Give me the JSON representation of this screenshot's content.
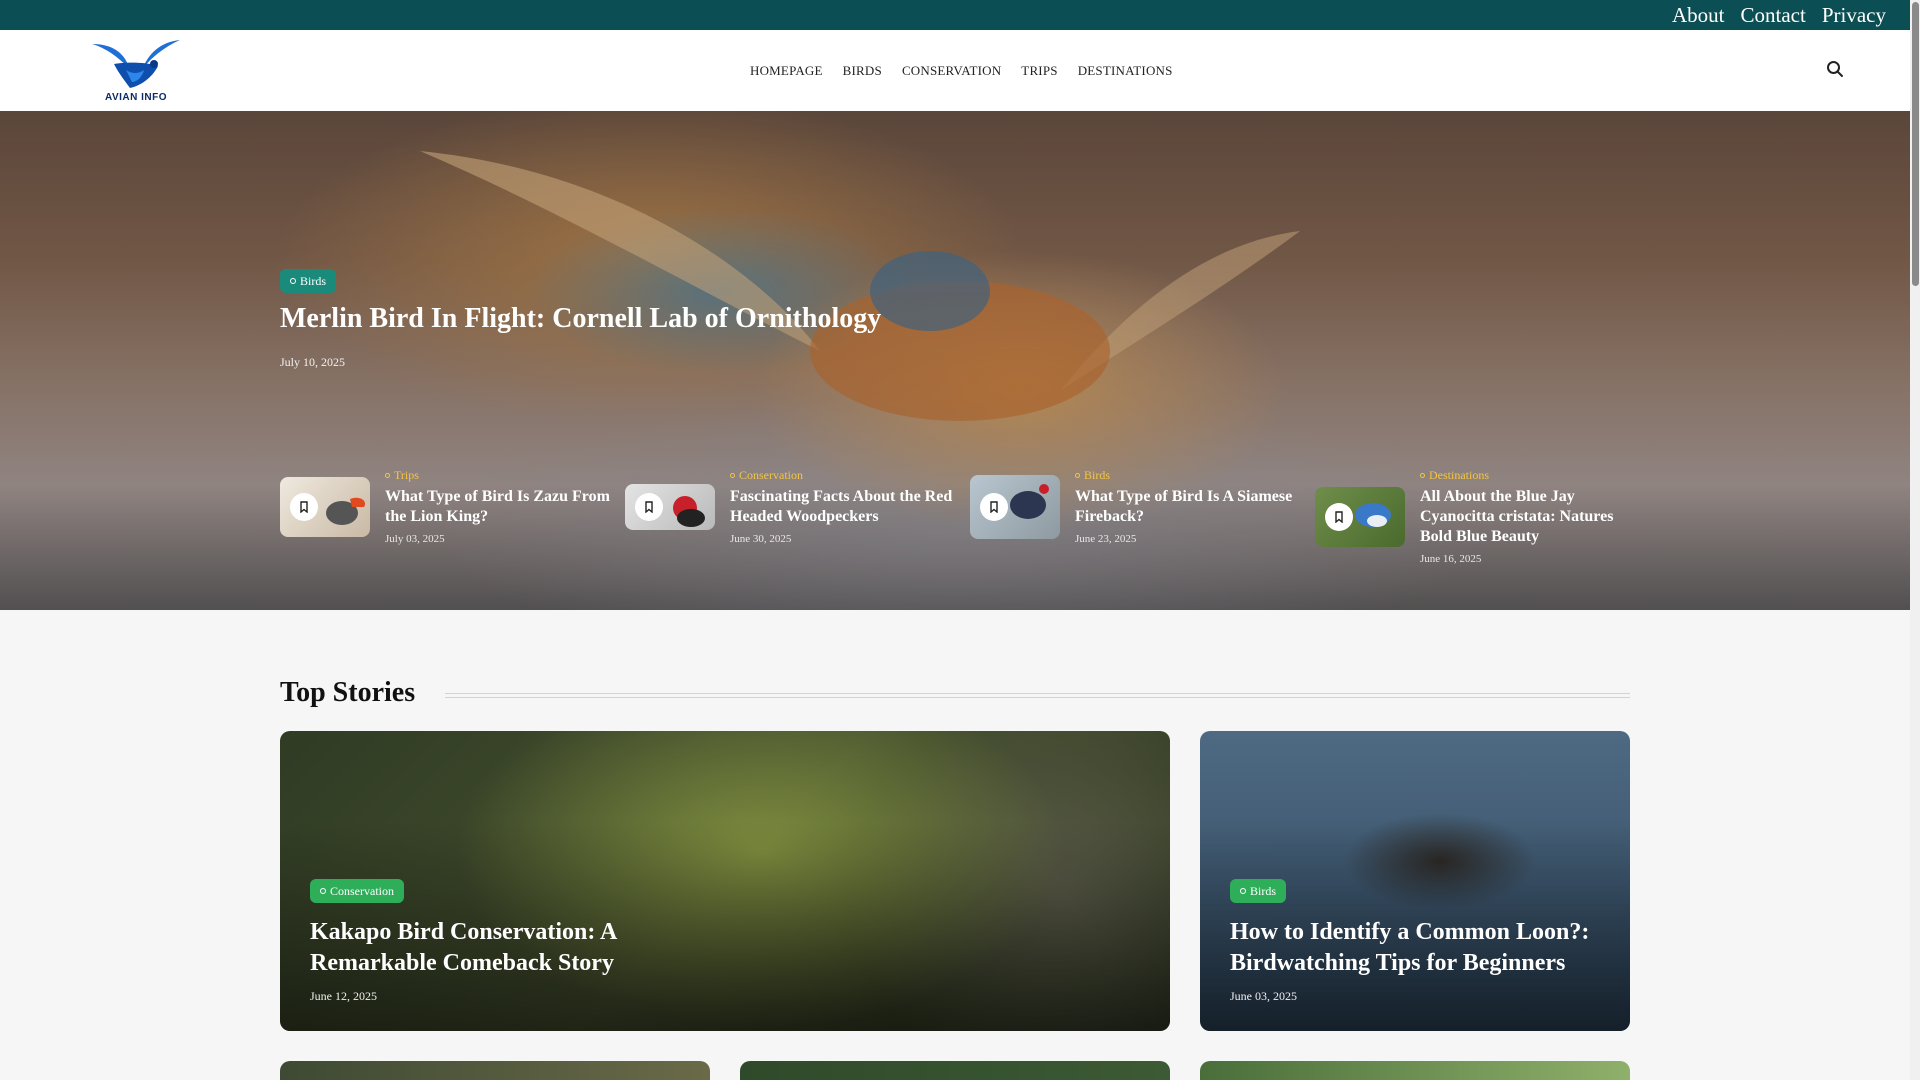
{
  "topbar": {
    "links": [
      "About",
      "Contact",
      "Privacy"
    ]
  },
  "header": {
    "logo_text": "AVIAN INFO",
    "nav": [
      "HOMEPAGE",
      "BIRDS",
      "CONSERVATION",
      "TRIPS",
      "DESTINATIONS"
    ],
    "search_icon": "search-icon"
  },
  "hero": {
    "category": "Birds",
    "title": "Merlin Bird In Flight: Cornell Lab of Ornithology",
    "date": "July 10, 2025",
    "posts": [
      {
        "category": "Trips",
        "title": "What Type of Bird Is Zazu From the Lion King?",
        "date": "July 03, 2025"
      },
      {
        "category": "Conservation",
        "title": "Fascinating Facts About the Red Headed Woodpeckers",
        "date": "June 30, 2025"
      },
      {
        "category": "Birds",
        "title": "What Type of Bird Is A Siamese Fireback?",
        "date": "June 23, 2025"
      },
      {
        "category": "Destinations",
        "title": "All About the Blue Jay Cyanocitta cristata: Natures Bold Blue Beauty",
        "date": "June 16, 2025"
      }
    ]
  },
  "top_stories": {
    "heading": "Top Stories",
    "cards": [
      {
        "category": "Conservation",
        "title": "Kakapo Bird Conservation: A Remarkable Comeback Story",
        "date": "June 12, 2025"
      },
      {
        "category": "Birds",
        "title": "How to Identify a Common Loon?: Birdwatching Tips for Beginners",
        "date": "June 03, 2025"
      }
    ]
  },
  "colors": {
    "topbar": "#0b4f54",
    "badge_teal": "#1a8a7a",
    "badge_green": "#2fae5a",
    "mini_category": "#f5c542"
  }
}
